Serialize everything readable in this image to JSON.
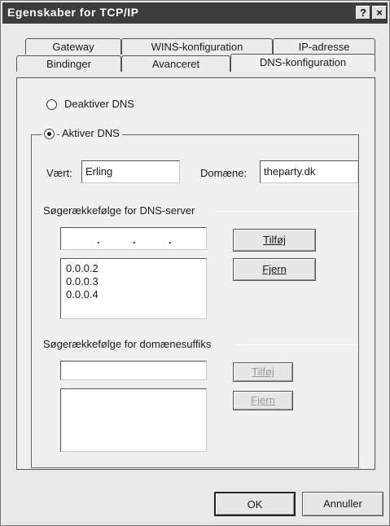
{
  "window": {
    "title": "Egenskaber for TCP/IP",
    "help": "?",
    "close": "×"
  },
  "tabs": {
    "row1": [
      {
        "label": "Gateway"
      },
      {
        "label": "WINS-konfiguration"
      },
      {
        "label": "IP-adresse"
      }
    ],
    "row2": [
      {
        "label": "Bindinger"
      },
      {
        "label": "Avanceret"
      },
      {
        "label": "DNS-konfiguration",
        "active": true
      }
    ]
  },
  "dns": {
    "disable_label": "Deaktiver DNS",
    "enable_label": "Aktiver DNS",
    "enabled": true,
    "host_label": "Vært:",
    "host_value": "Erling",
    "domain_label": "Domæne:",
    "domain_value": "theparty.dk",
    "server_order": {
      "heading": "Søgerækkefølge for DNS-server",
      "ip_input_dots": [
        ".",
        ".",
        "."
      ],
      "add_label": "Tilføj",
      "remove_label": "Fjern",
      "servers": [
        "0.0.0.2",
        "0.0.0.3",
        "0.0.0.4"
      ]
    },
    "suffix_order": {
      "heading": "Søgerækkefølge for domænesuffiks",
      "input_value": "",
      "add_label": "Tilføj",
      "remove_label": "Fjern",
      "suffixes": []
    }
  },
  "footer": {
    "ok_label": "OK",
    "cancel_label": "Annuller"
  }
}
